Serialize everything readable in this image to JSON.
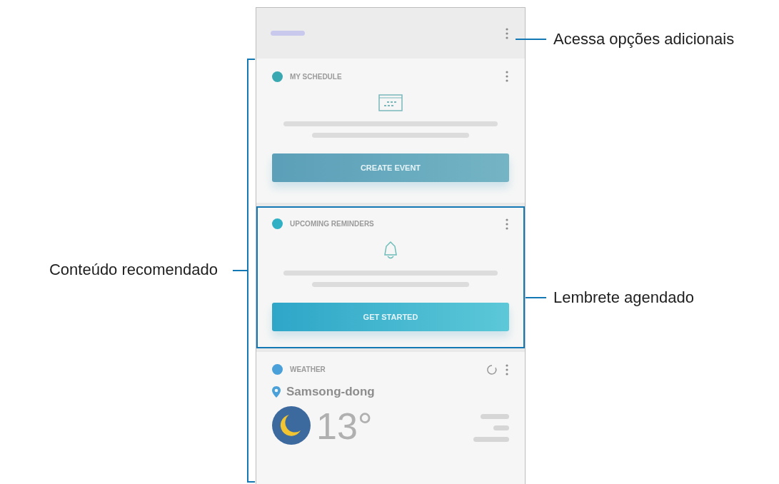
{
  "screen": {
    "cards": [
      {
        "kind": "schedule",
        "title": "MY SCHEDULE",
        "button": "CREATE EVENT",
        "highlighted": false
      },
      {
        "kind": "reminder",
        "title": "UPCOMING REMINDERS",
        "button": "GET STARTED",
        "highlighted": true
      },
      {
        "kind": "weather",
        "title": "WEATHER",
        "location": "Samsong-dong",
        "temperature": "13°",
        "highlighted": false
      }
    ]
  },
  "callouts": [
    {
      "label": "Acessa opções adicionais"
    },
    {
      "label": "Conteúdo recomendado"
    },
    {
      "label": "Lembrete agendado"
    }
  ]
}
